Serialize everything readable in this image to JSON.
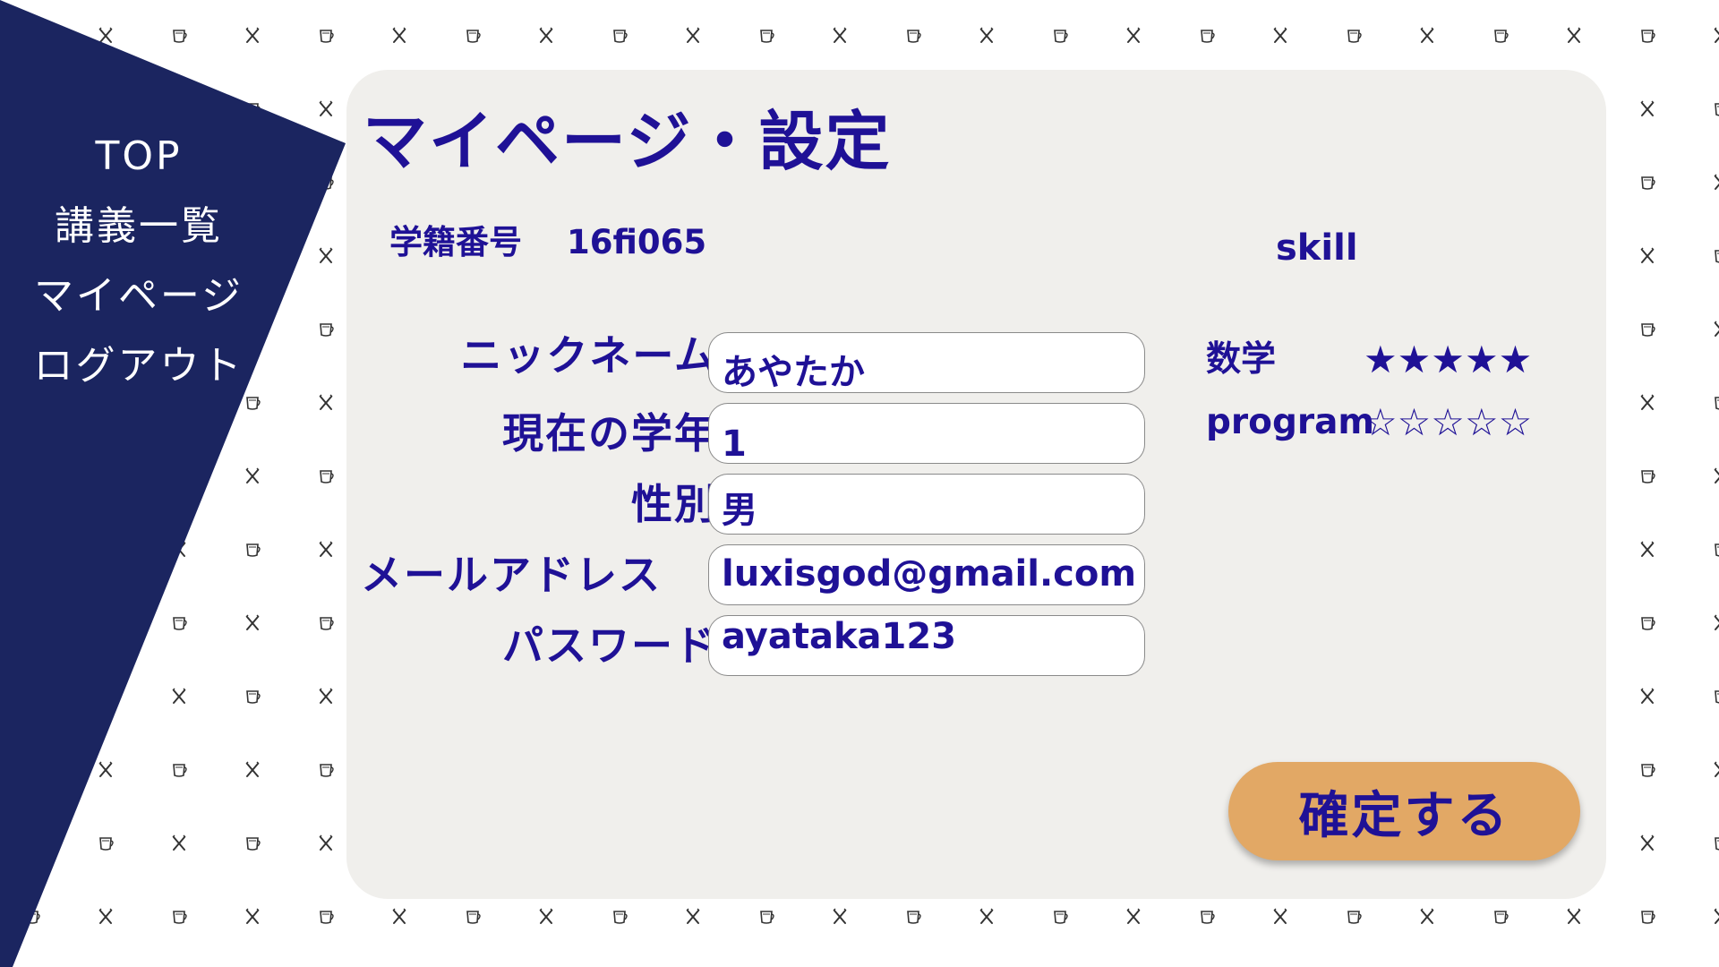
{
  "sidebar": {
    "color": "#1b2560",
    "items": [
      {
        "label": "TOP"
      },
      {
        "label": "講義一覧"
      },
      {
        "label": "マイページ"
      },
      {
        "label": "ログアウト"
      }
    ]
  },
  "background": {
    "pattern_icons": [
      "fork-knife-icon",
      "cup-icon"
    ]
  },
  "page": {
    "title": "マイページ・設定",
    "student_id_label": "学籍番号",
    "student_id_value": "16fi065"
  },
  "form": {
    "fields": [
      {
        "label": "ニックネーム",
        "value": "あやたか"
      },
      {
        "label": "現在の学年",
        "value": "1"
      },
      {
        "label": "性別",
        "value": "男"
      },
      {
        "label": "メールアドレス",
        "value": "luxisgod@gmail.com"
      },
      {
        "label": "パスワード",
        "value": "ayataka123"
      }
    ]
  },
  "skill": {
    "heading": "skill",
    "items": [
      {
        "name": "数学",
        "rating": 5,
        "max": 5,
        "stars": "★★★★★"
      },
      {
        "name": "program",
        "rating": 0,
        "max": 5,
        "stars": "☆☆☆☆☆"
      }
    ]
  },
  "actions": {
    "confirm_label": "確定する"
  },
  "colors": {
    "accent_text": "#1f1196",
    "panel": "#f0efec",
    "button": "#e2a865",
    "sidebar": "#1b2560"
  }
}
